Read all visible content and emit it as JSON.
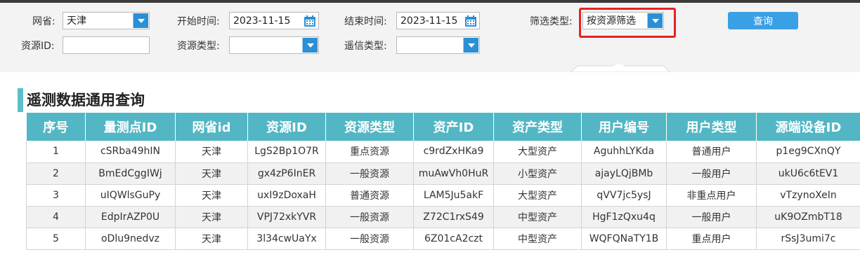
{
  "colors": {
    "header_bg": "#53b6c4",
    "accent": "#2b8fd6",
    "query_button": "#3aa0e6",
    "highlight_border": "#e82222"
  },
  "filters": {
    "province_label": "网省:",
    "province_value": "天津",
    "start_label": "开始时间:",
    "start_value": "2023-11-15",
    "end_label": "结束时间:",
    "end_value": "2023-11-15",
    "filter_type_label": "筛选类型:",
    "filter_type_value": "按资源筛选",
    "resource_id_label": "资源ID:",
    "resource_id_value": "",
    "resource_type_label": "资源类型:",
    "resource_type_value": "",
    "telesignal_type_label": "遥信类型:",
    "telesignal_type_value": "",
    "query_label": "查询"
  },
  "section_title": "遥测数据通用查询",
  "table": {
    "columns": [
      "序号",
      "量测点ID",
      "网省id",
      "资源ID",
      "资源类型",
      "资产ID",
      "资产类型",
      "用户编号",
      "用户类型",
      "源端设备ID"
    ],
    "rows": [
      [
        "1",
        "cSRba49hIN",
        "天津",
        "LgS2Bp1O7R",
        "重点资源",
        "c9rdZxHKa9",
        "大型资产",
        "AguhhLYKda",
        "普通用户",
        "p1eg9CXnQY"
      ],
      [
        "2",
        "BmEdCggIWj",
        "天津",
        "gx4zP6InER",
        "一般资源",
        "muAwVh0HuR",
        "小型资产",
        "ajayLQjBMb",
        "一般用户",
        "ukU6c6tEV1"
      ],
      [
        "3",
        "uIQWlsGuPy",
        "天津",
        "uxI9zDoxaH",
        "普通资源",
        "LAM5Ju5akF",
        "大型资产",
        "qVV7jc5ysJ",
        "非重点用户",
        "vTzynoXeIn"
      ],
      [
        "4",
        "EdpIrAZP0U",
        "天津",
        "VPJ72xkYVR",
        "一般资源",
        "Z72C1rxS49",
        "中型资产",
        "HgF1zQxu4q",
        "一般用户",
        "uK9OZmbT18"
      ],
      [
        "5",
        "oDlu9nedvz",
        "天津",
        "3l34cwUaYx",
        "一般资源",
        "6Z01cA2czt",
        "中型资产",
        "WQFQNaTY1B",
        "重点用户",
        "rSsJ3umi7c"
      ]
    ]
  }
}
